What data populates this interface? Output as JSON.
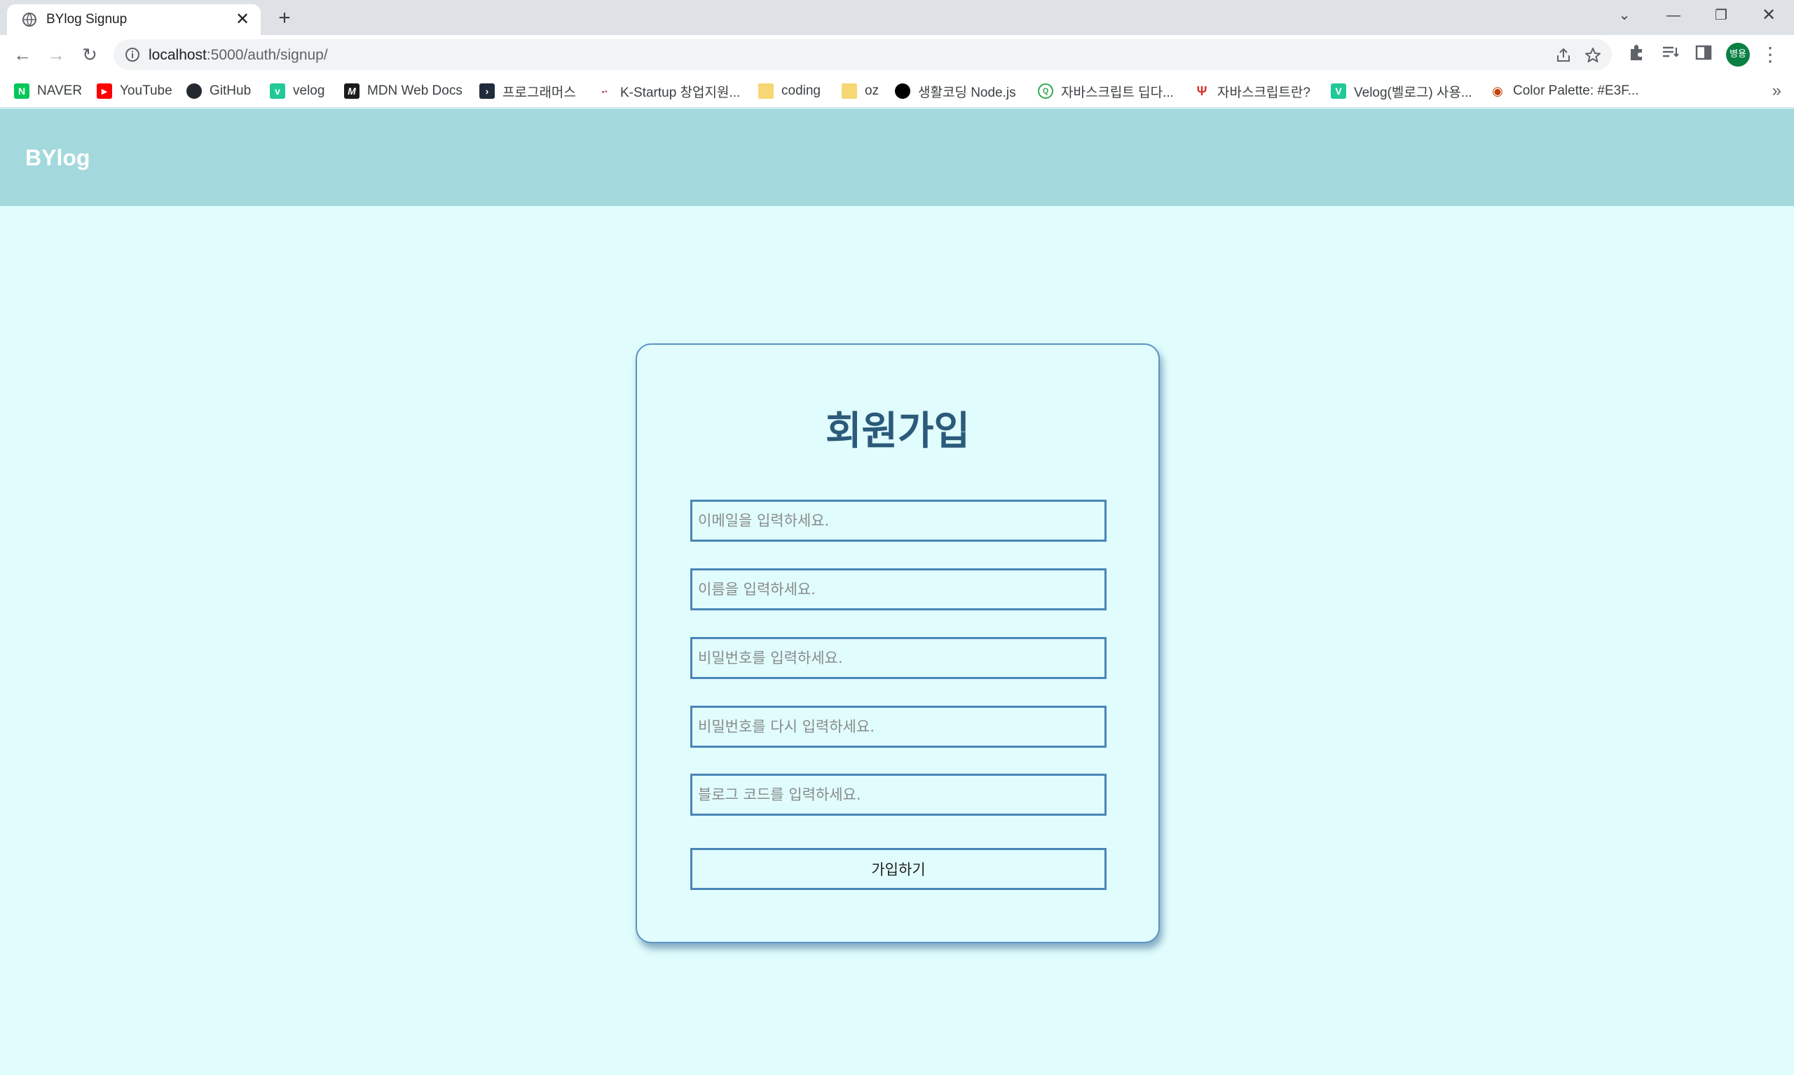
{
  "browser": {
    "tab_title": "BYlog Signup",
    "url_host": "localhost",
    "url_rest": ":5000/auth/signup/",
    "profile_initials": "병용",
    "bookmarks": [
      {
        "label": "NAVER",
        "icon": "naver-icon",
        "color": "#03c75a",
        "glyph": "N"
      },
      {
        "label": "YouTube",
        "icon": "youtube-icon",
        "color": "#ff0000",
        "glyph": "▶"
      },
      {
        "label": "GitHub",
        "icon": "github-icon",
        "color": "#24292f",
        "glyph": "●"
      },
      {
        "label": "velog",
        "icon": "velog-icon",
        "color": "#20c997",
        "glyph": "v"
      },
      {
        "label": "MDN Web Docs",
        "icon": "mdn-icon",
        "color": "#1b1b1b",
        "glyph": "M"
      },
      {
        "label": "프로그래머스",
        "icon": "programmers-icon",
        "color": "#202b3d",
        "glyph": "›"
      },
      {
        "label": "K-Startup 창업지원...",
        "icon": "k-startup-icon",
        "color": "#ffffff",
        "glyph": "-"
      },
      {
        "label": "coding",
        "icon": "folder-icon",
        "color": "#f7d774",
        "glyph": ""
      },
      {
        "label": "oz",
        "icon": "folder-icon",
        "color": "#f7d774",
        "glyph": ""
      },
      {
        "label": "생활코딩 Node.js",
        "icon": "opentutorials-icon",
        "color": "#000000",
        "glyph": "●"
      },
      {
        "label": "자바스크립트 딥다...",
        "icon": "search-site-icon",
        "color": "#ffffff",
        "glyph": "Q"
      },
      {
        "label": "자바스크립트란?",
        "icon": "tower-icon",
        "color": "#ffffff",
        "glyph": "Ψ"
      },
      {
        "label": "Velog(벨로그) 사용...",
        "icon": "velog-icon",
        "color": "#20c997",
        "glyph": "V"
      },
      {
        "label": "Color Palette: #E3F...",
        "icon": "palette-icon",
        "color": "#ffffff",
        "glyph": "◉"
      }
    ]
  },
  "site": {
    "brand": "BYlog",
    "header_bg": "#a3d9dd",
    "page_bg": "#e0fcfc",
    "accent": "#4a85b8"
  },
  "signup": {
    "title": "회원가입",
    "email_placeholder": "이메일을 입력하세요.",
    "name_placeholder": "이름을 입력하세요.",
    "password_placeholder": "비밀번호를 입력하세요.",
    "password_confirm_placeholder": "비밀번호를 다시 입력하세요.",
    "blog_code_placeholder": "블로그 코드를 입력하세요.",
    "submit_label": "가입하기"
  }
}
